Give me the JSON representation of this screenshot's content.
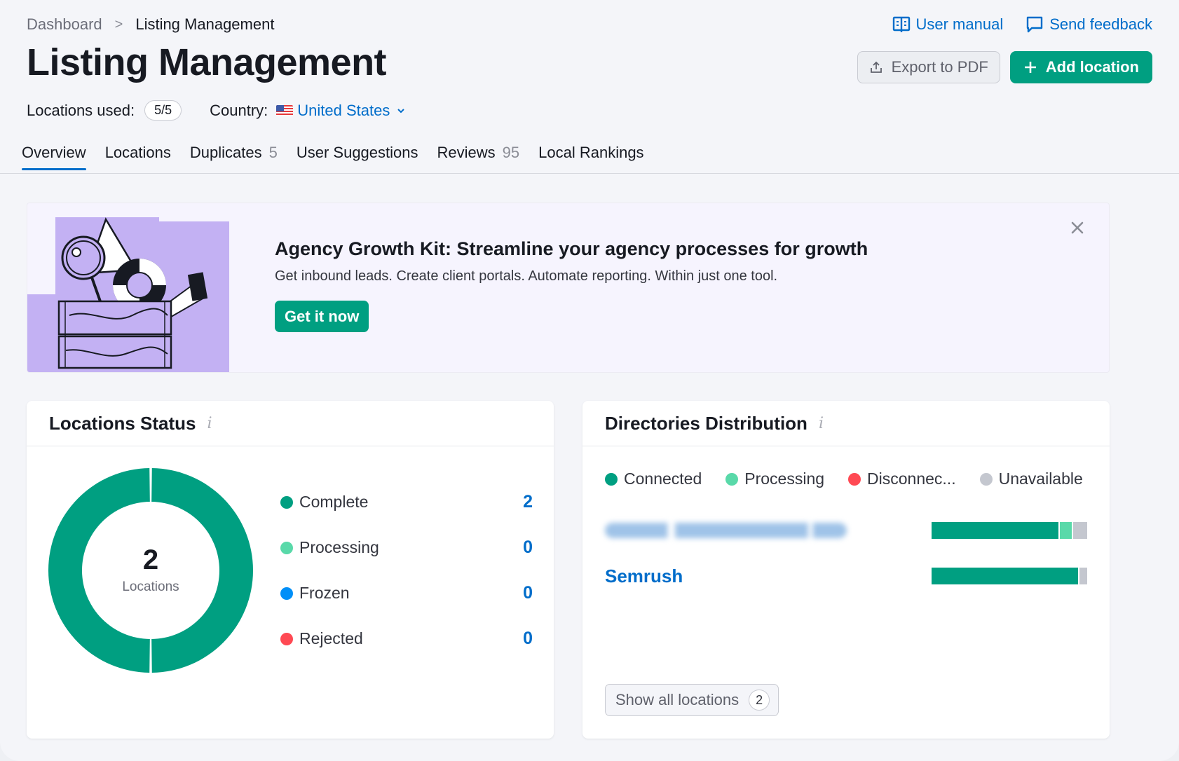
{
  "breadcrumb": {
    "root": "Dashboard",
    "separator": ">",
    "current": "Listing Management"
  },
  "header": {
    "title": "Listing Management",
    "locations_used_label": "Locations used:",
    "locations_used_value": "5/5",
    "country_label": "Country:",
    "country_value": "United States",
    "links": {
      "user_manual": "User manual",
      "send_feedback": "Send feedback"
    },
    "actions": {
      "export": "Export to PDF",
      "add_location": "Add location"
    }
  },
  "tabs": [
    {
      "label": "Overview",
      "count": null,
      "active": true
    },
    {
      "label": "Locations",
      "count": null
    },
    {
      "label": "Duplicates",
      "count": "5"
    },
    {
      "label": "User Suggestions",
      "count": null
    },
    {
      "label": "Reviews",
      "count": "95"
    },
    {
      "label": "Local Rankings",
      "count": null
    }
  ],
  "banner": {
    "title": "Agency Growth Kit: Streamline your agency processes for growth",
    "text": "Get inbound leads. Create client portals. Automate reporting. Within just one tool.",
    "cta": "Get it now",
    "close_icon": "close-icon"
  },
  "locations_status": {
    "title": "Locations Status",
    "info_icon": "i",
    "total": "2",
    "total_label": "Locations",
    "items": [
      {
        "label": "Complete",
        "value": 2,
        "color": "#009f81"
      },
      {
        "label": "Processing",
        "value": 0,
        "color": "#59d9a9"
      },
      {
        "label": "Frozen",
        "value": 0,
        "color": "#008ff8"
      },
      {
        "label": "Rejected",
        "value": 0,
        "color": "#ff4953"
      }
    ]
  },
  "directories_distribution": {
    "title": "Directories Distribution",
    "info_icon": "i",
    "legend": [
      {
        "label": "Connected",
        "color": "#009f81"
      },
      {
        "label": "Processing",
        "color": "#59d9a9"
      },
      {
        "label": "Disconnec...",
        "color": "#ff4953"
      },
      {
        "label": "Unavailable",
        "color": "#c4c7cf"
      }
    ],
    "rows": [
      {
        "name": "",
        "blurred": true,
        "segments": [
          0.83,
          0.08,
          0,
          0.09
        ]
      },
      {
        "name": "Semrush",
        "blurred": false,
        "segments": [
          0.95,
          0,
          0,
          0.05
        ]
      }
    ],
    "show_all_label": "Show all locations",
    "show_all_count": "2"
  },
  "colors": {
    "accent_green": "#009f81",
    "link_blue": "#006dca"
  }
}
